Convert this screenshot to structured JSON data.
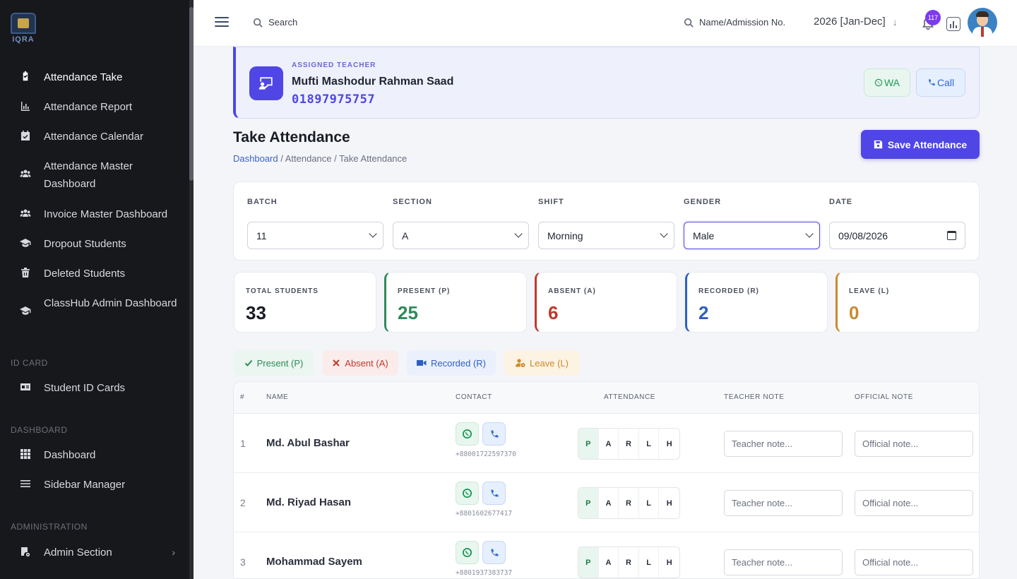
{
  "sidebar": {
    "logo_text": "IQRA",
    "items": [
      {
        "label": "Attendance Take",
        "icon": "clipboard-check-icon",
        "active": true
      },
      {
        "label": "Attendance Report",
        "icon": "bar-chart-icon"
      },
      {
        "label": "Attendance Calendar",
        "icon": "calendar-check-icon"
      },
      {
        "label": "Attendance Master Dashboard",
        "icon": "users-icon"
      },
      {
        "label": "Invoice Master Dashboard",
        "icon": "users-icon"
      },
      {
        "label": "Dropout Students",
        "icon": "graduation-cap-icon"
      },
      {
        "label": "Deleted Students",
        "icon": "trash-icon"
      },
      {
        "label": "ClassHub Admin Dashboard",
        "icon": "graduation-cap-icon"
      },
      {
        "label": "Student ID Cards",
        "icon": "id-card-icon"
      },
      {
        "label": "Dashboard",
        "icon": "grid-icon"
      },
      {
        "label": "Sidebar Manager",
        "icon": "list-icon"
      },
      {
        "label": "Admin Section",
        "icon": "admin-gear-icon"
      }
    ],
    "sections": {
      "id_card": "ID CARD",
      "dashboard": "DASHBOARD",
      "administration": "ADMINISTRATION"
    }
  },
  "topbar": {
    "search_label": "Search",
    "admission_search_label": "Name/Admission No.",
    "session": "2026 [Jan-Dec]",
    "notification_count": "117"
  },
  "teacher": {
    "label": "ASSIGNED TEACHER",
    "name": "Mufti Mashodur Rahman Saad",
    "phone": "01897975757",
    "wa_label": "WA",
    "call_label": "Call"
  },
  "page": {
    "title": "Take Attendance",
    "breadcrumb": {
      "home": "Dashboard",
      "sep1": " / ",
      "mid": "Attendance",
      "sep2": " / ",
      "current": "Take Attendance"
    },
    "save_label": "Save Attendance"
  },
  "filters": {
    "batch": {
      "label": "BATCH",
      "value": "11"
    },
    "section": {
      "label": "SECTION",
      "value": "A"
    },
    "shift": {
      "label": "SHIFT",
      "value": "Morning"
    },
    "gender": {
      "label": "GENDER",
      "value": "Male"
    },
    "date": {
      "label": "DATE",
      "value": "09/08/2026"
    }
  },
  "stats": {
    "total": {
      "label": "TOTAL STUDENTS",
      "value": "33",
      "color": "#1a1d26"
    },
    "present": {
      "label": "PRESENT (P)",
      "value": "25",
      "color": "#2f8a5b"
    },
    "absent": {
      "label": "ABSENT (A)",
      "value": "6",
      "color": "#c0392b"
    },
    "recorded": {
      "label": "RECORDED (R)",
      "value": "2",
      "color": "#2f5fc4"
    },
    "leave": {
      "label": "LEAVE (L)",
      "value": "0",
      "color": "#c98a2e"
    }
  },
  "legend": {
    "present": "Present (P)",
    "absent": "Absent (A)",
    "recorded": "Recorded (R)",
    "leave": "Leave (L)"
  },
  "table": {
    "headers": {
      "num": "#",
      "name": "NAME",
      "contact": "CONTACT",
      "attendance": "ATTENDANCE",
      "teacher_note": "TEACHER NOTE",
      "official_note": "OFFICIAL NOTE"
    },
    "attendance_options": [
      "P",
      "A",
      "R",
      "L",
      "H"
    ],
    "teacher_note_placeholder": "Teacher note...",
    "official_note_placeholder": "Official note...",
    "rows": [
      {
        "num": "1",
        "name": "Md. Abul Bashar",
        "contact": "+88001722597370",
        "selected": "P"
      },
      {
        "num": "2",
        "name": "Md. Riyad Hasan",
        "contact": "+8801602677417",
        "selected": "P"
      },
      {
        "num": "3",
        "name": "Mohammad Sayem",
        "contact": "+8801937383737",
        "selected": "P"
      }
    ]
  }
}
